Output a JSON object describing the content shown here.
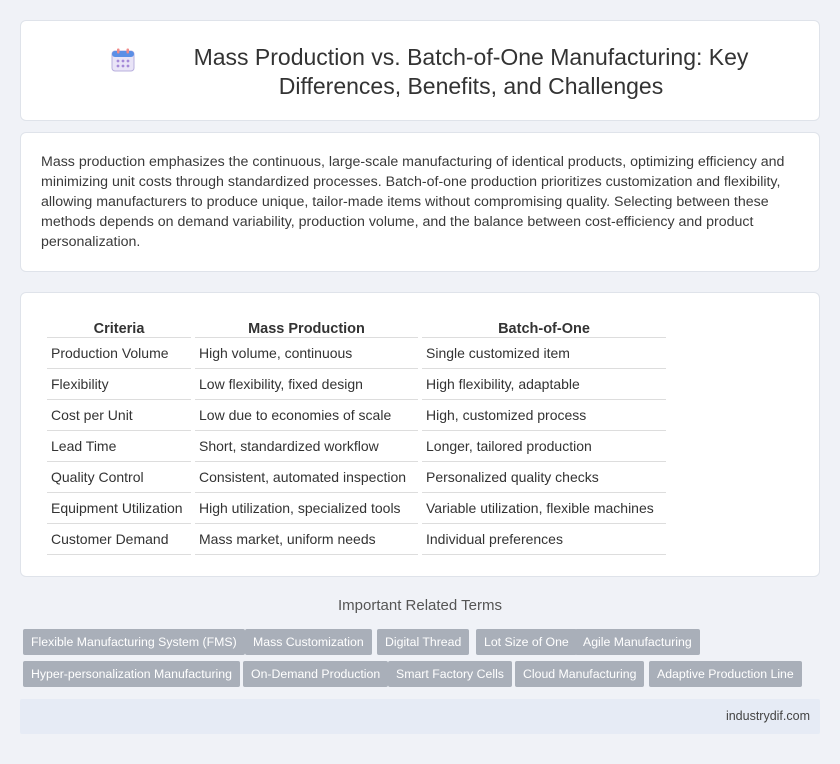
{
  "header": {
    "title": "Mass Production vs. Batch-of-One Manufacturing: Key Differences, Benefits, and Challenges",
    "icon": "calendar-icon"
  },
  "intro": {
    "text": "Mass production emphasizes the continuous, large-scale manufacturing of identical products, optimizing efficiency and minimizing unit costs through standardized processes. Batch-of-one production prioritizes customization and flexibility, allowing manufacturers to produce unique, tailor-made items without compromising quality. Selecting between these methods depends on demand variability, production volume, and the balance between cost-efficiency and product personalization."
  },
  "table": {
    "headers": [
      "Criteria",
      "Mass Production",
      "Batch-of-One"
    ],
    "rows": [
      [
        "Production Volume",
        "High volume, continuous",
        "Single customized item"
      ],
      [
        "Flexibility",
        "Low flexibility, fixed design",
        "High flexibility, adaptable"
      ],
      [
        "Cost per Unit",
        "Low due to economies of scale",
        "High, customized process"
      ],
      [
        "Lead Time",
        "Short, standardized workflow",
        "Longer, tailored production"
      ],
      [
        "Quality Control",
        "Consistent, automated inspection",
        "Personalized quality checks"
      ],
      [
        "Equipment Utilization",
        "High utilization, specialized tools",
        "Variable utilization, flexible machines"
      ],
      [
        "Customer Demand",
        "Mass market, uniform needs",
        "Individual preferences"
      ]
    ]
  },
  "related": {
    "title": "Important Related Terms",
    "tags": [
      "Flexible Manufacturing System (FMS)",
      "Mass Customization",
      "Digital Thread",
      "Lot Size of One",
      "Agile Manufacturing",
      "Hyper-personalization Manufacturing",
      "On-Demand Production",
      "Smart Factory Cells",
      "Cloud Manufacturing",
      "Adaptive Production Line"
    ]
  },
  "footer": {
    "site": "industrydif.com"
  }
}
